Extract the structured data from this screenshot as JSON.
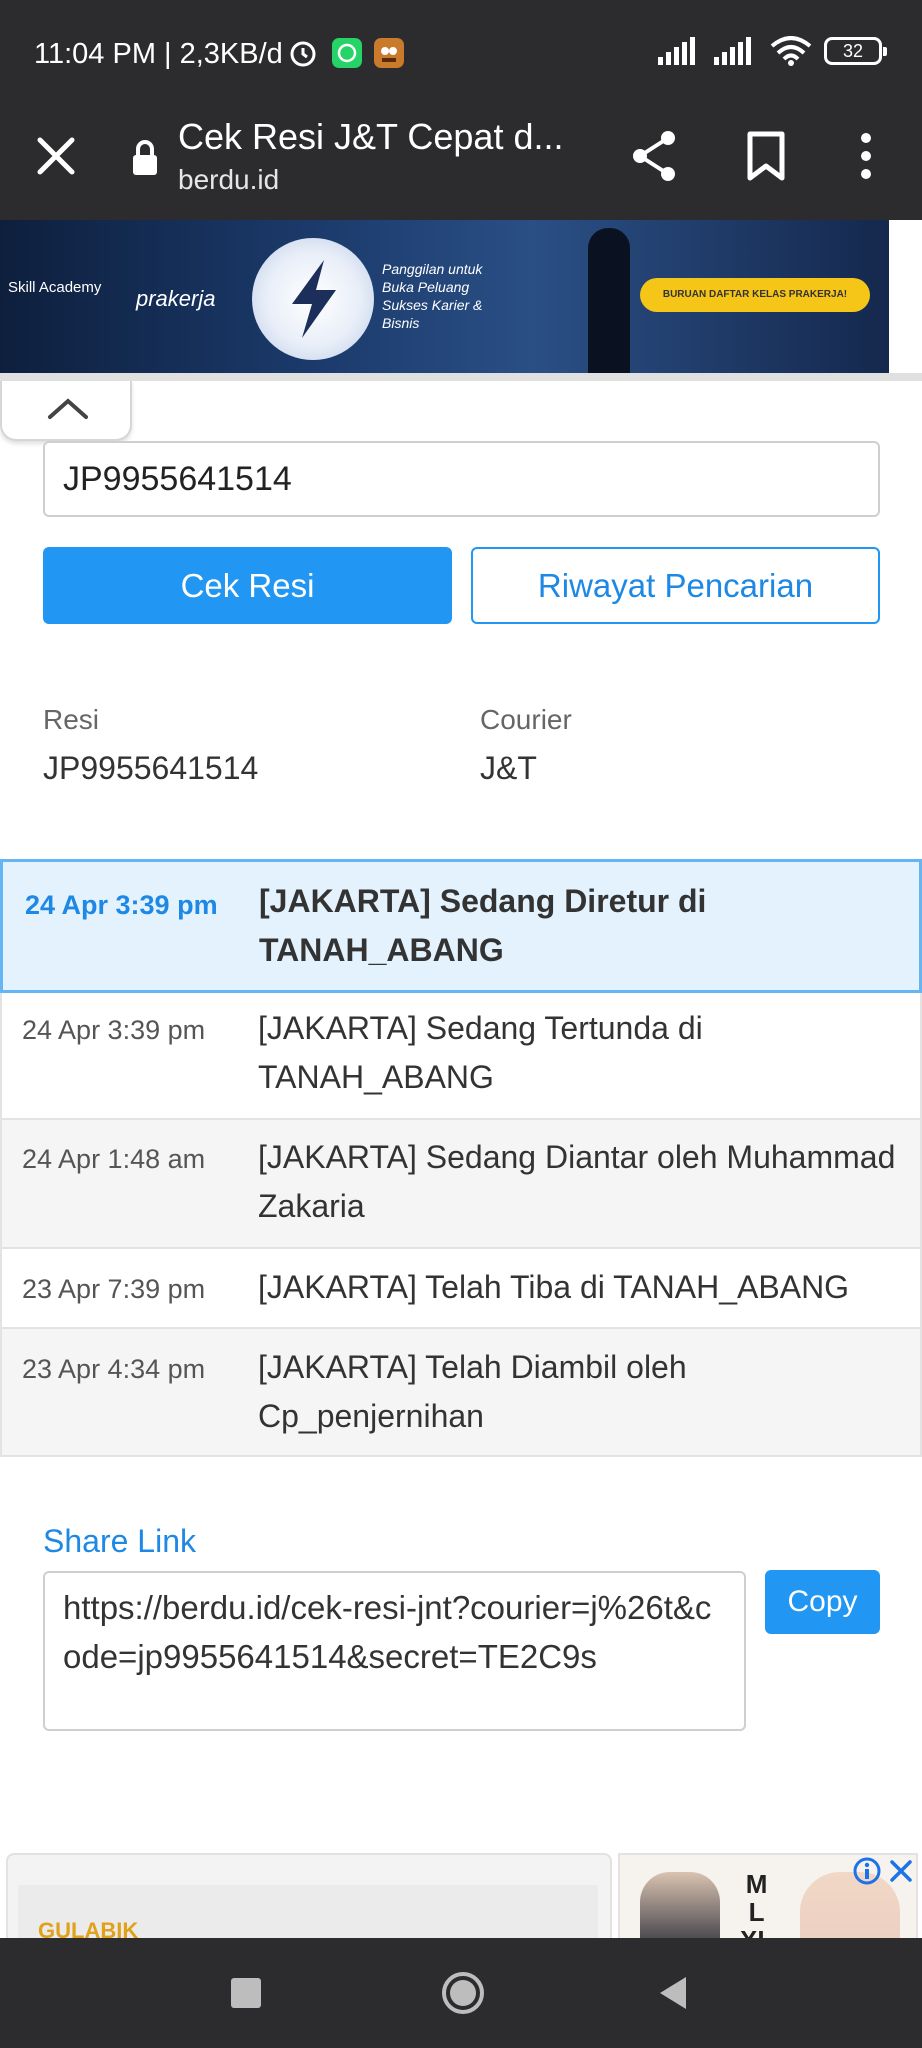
{
  "status_bar": {
    "time": "11:04 PM | 2,3KB/d",
    "battery": "32"
  },
  "browser": {
    "title": "Cek Resi J&T Cepat d...",
    "domain": "berdu.id"
  },
  "banner_ad": {
    "logo_text": "Skill Academy",
    "partner": "prakerja",
    "headline": "Panggilan untuk Buka Peluang Sukses Karier & Bisnis",
    "cta": "BURUAN DAFTAR KELAS PRAKERJA!"
  },
  "form": {
    "tracking_value": "JP9955641514",
    "check_button": "Cek Resi",
    "history_button": "Riwayat Pencarian"
  },
  "summary": {
    "resi_label": "Resi",
    "resi_value": "JP9955641514",
    "courier_label": "Courier",
    "courier_value": "J&T"
  },
  "timeline": [
    {
      "time": "24 Apr 3:39 pm",
      "desc": "[JAKARTA] Sedang Diretur di TANAH_ABANG",
      "active": true
    },
    {
      "time": "24 Apr 3:39 pm",
      "desc": "[JAKARTA] Sedang Tertunda di TANAH_ABANG",
      "active": false
    },
    {
      "time": "24 Apr 1:48 am",
      "desc": "[JAKARTA] Sedang Diantar oleh Muhammad Zakaria",
      "active": false
    },
    {
      "time": "23 Apr 7:39 pm",
      "desc": "[JAKARTA] Telah Tiba di TANAH_ABANG",
      "active": false
    },
    {
      "time": "23 Apr 4:34 pm",
      "desc": "[JAKARTA] Telah Diambil oleh Cp_penjernihan",
      "active": false
    }
  ],
  "share": {
    "label": "Share Link",
    "url": "https://berdu.id/cek-resi-jnt?courier=j%26t&code=jp9955641514&secret=TE2C9s",
    "copy_button": "Copy"
  },
  "bottom_ad": {
    "left_text": "GULABIK",
    "sizes": "M\nL\nXL"
  },
  "colors": {
    "accent": "#2196f3",
    "active_row_bg": "#e3f2fd",
    "chrome_bg": "#2c2c2e"
  }
}
